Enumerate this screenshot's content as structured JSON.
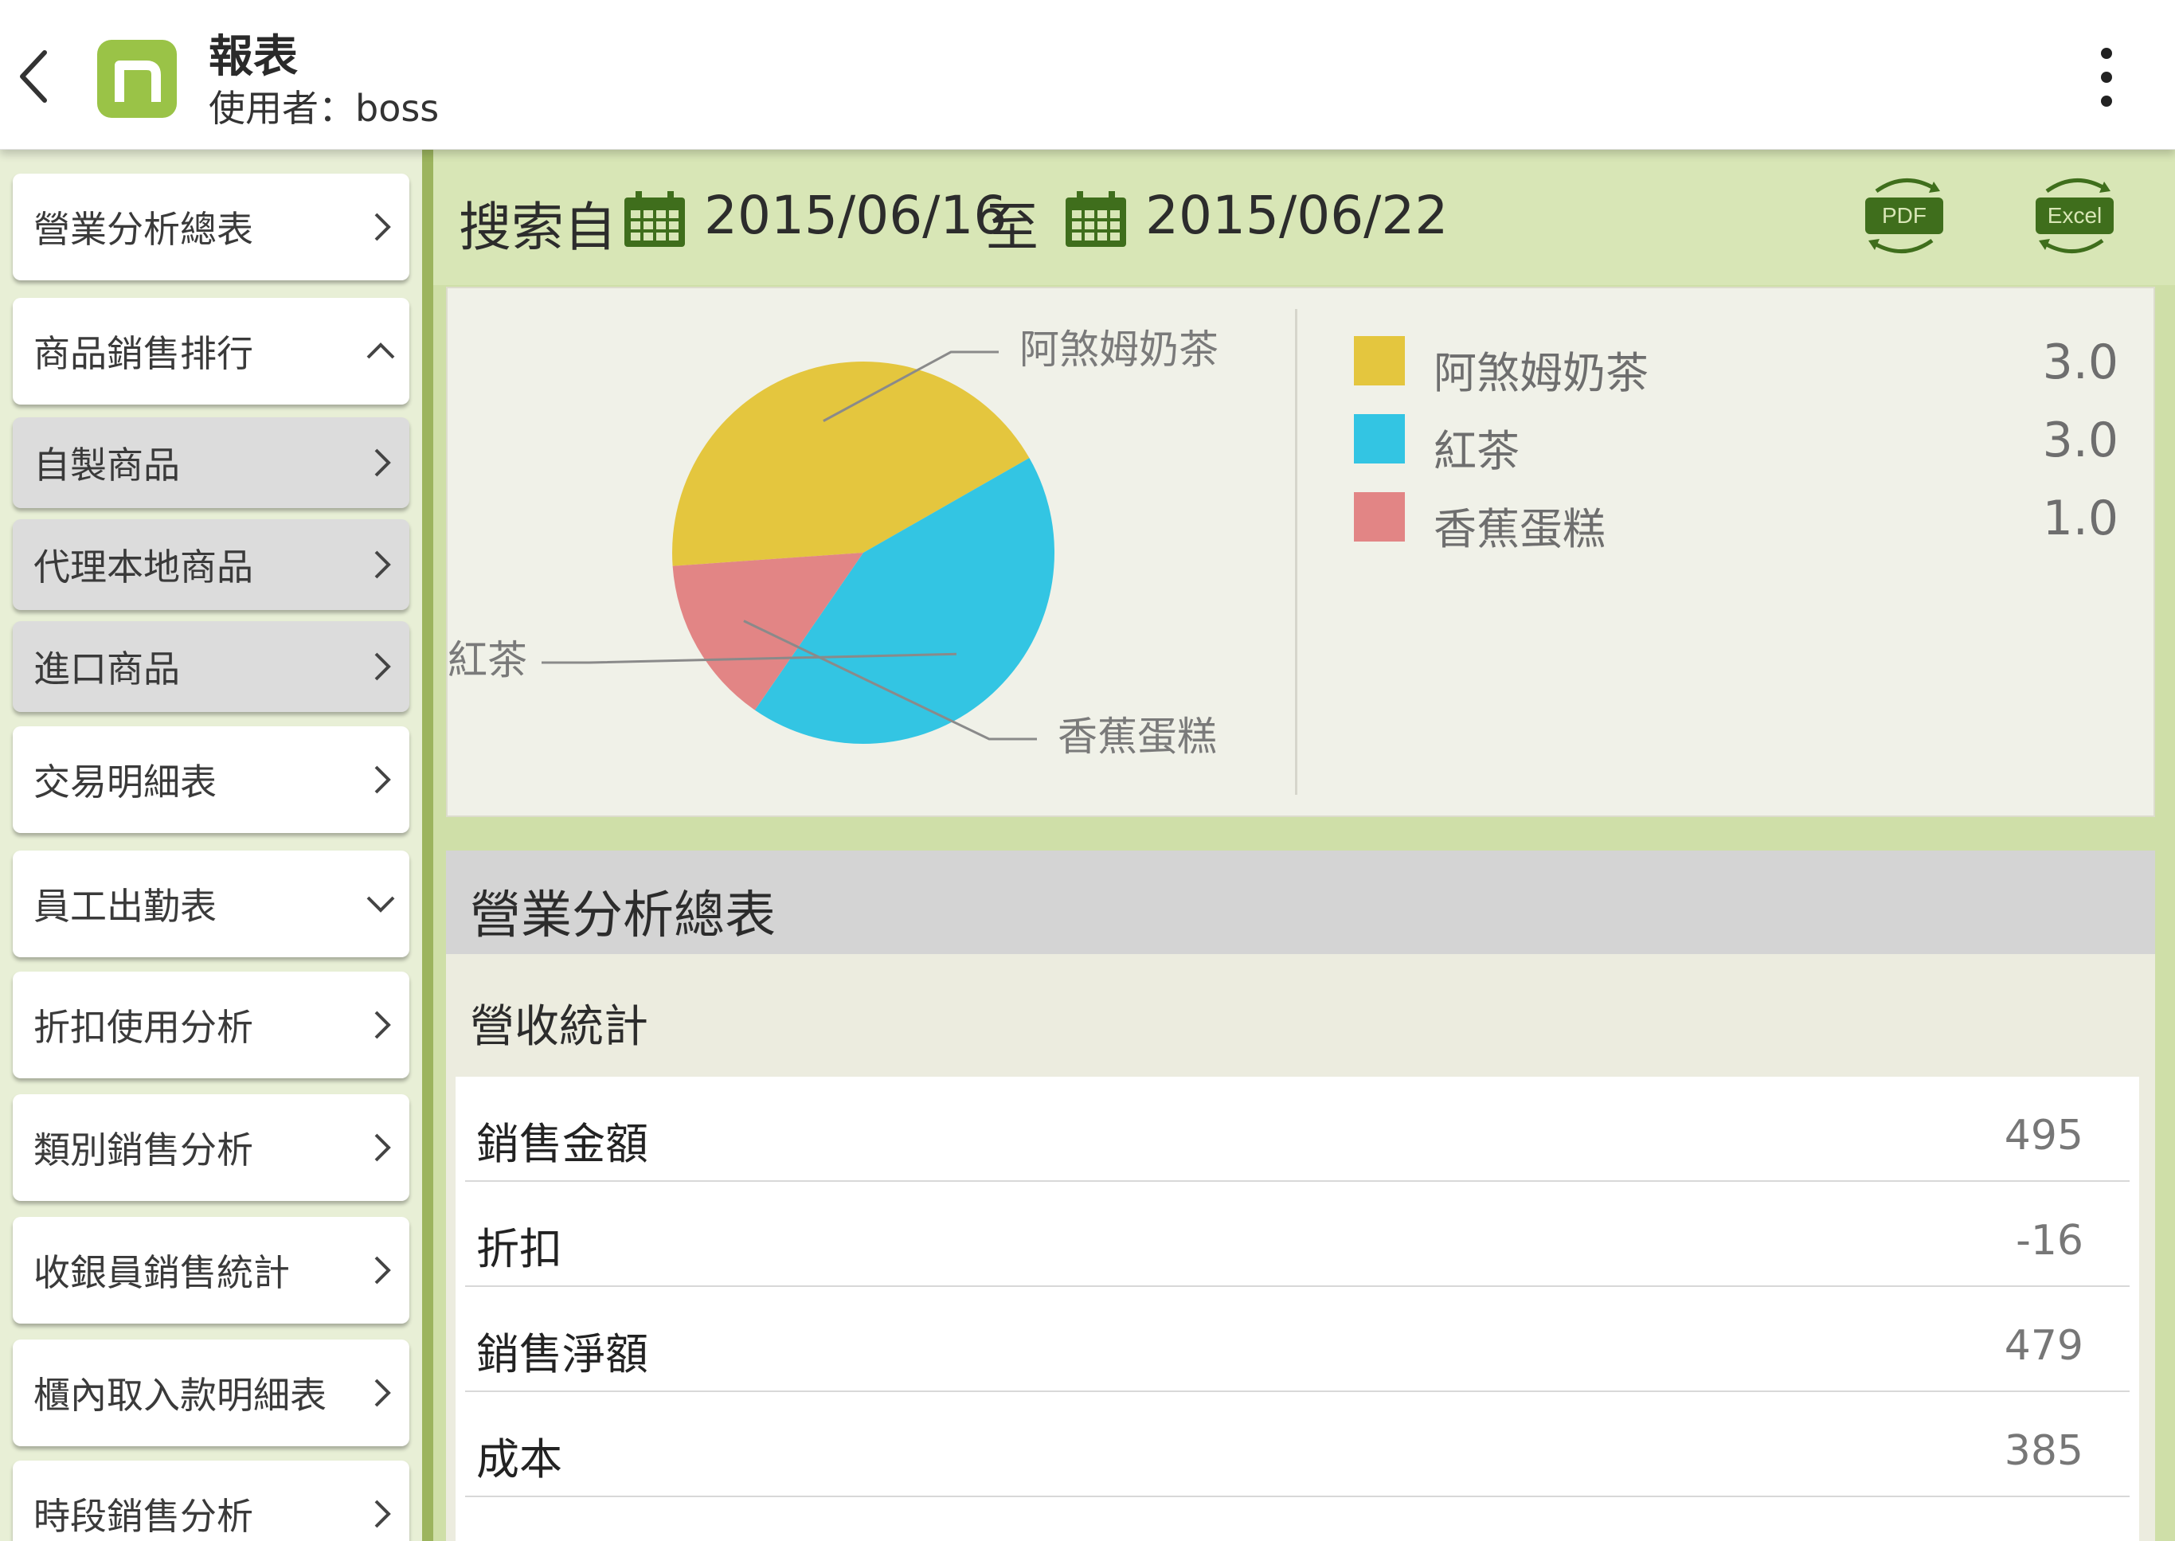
{
  "header": {
    "title": "報表",
    "user_label": "使用者：boss"
  },
  "sidebar": {
    "items": [
      {
        "label": "營業分析總表",
        "arrow": "chevron-right"
      },
      {
        "label": "商品銷售排行",
        "arrow": "chevron-up"
      },
      {
        "label": "自製商品",
        "arrow": "chevron-right"
      },
      {
        "label": "代理本地商品",
        "arrow": "chevron-right"
      },
      {
        "label": "進口商品",
        "arrow": "chevron-right"
      },
      {
        "label": "交易明細表",
        "arrow": "chevron-right"
      },
      {
        "label": "員工出勤表",
        "arrow": "chevron-down"
      },
      {
        "label": "折扣使用分析",
        "arrow": "chevron-right"
      },
      {
        "label": "類別銷售分析",
        "arrow": "chevron-right"
      },
      {
        "label": "收銀員銷售統計",
        "arrow": "chevron-right"
      },
      {
        "label": "櫃內取入款明細表",
        "arrow": "chevron-right"
      },
      {
        "label": "時段銷售分析",
        "arrow": "chevron-right"
      }
    ]
  },
  "search": {
    "prefix": "搜索自",
    "start_date": "2015/06/16",
    "separator": "至",
    "end_date": "2015/06/22",
    "pdf_label": "PDF",
    "excel_label": "Excel"
  },
  "chart_data": {
    "type": "pie",
    "categories": [
      "阿煞姆奶茶",
      "紅茶",
      "香蕉蛋糕"
    ],
    "values": [
      3.0,
      3.0,
      1.0
    ],
    "value_labels": [
      "3.0",
      "3.0",
      "1.0"
    ],
    "colors": [
      "#e4c63e",
      "#33c5e3",
      "#e28585"
    ],
    "legend_placement": "right"
  },
  "summary": {
    "title": "營業分析總表",
    "subtitle": "營收統計",
    "rows": [
      {
        "label": "銷售金額",
        "value": "495"
      },
      {
        "label": "折扣",
        "value": "-16"
      },
      {
        "label": "銷售淨額",
        "value": "479"
      },
      {
        "label": "成本",
        "value": "385"
      }
    ]
  },
  "colors": {
    "brand_green": "#9ac347",
    "icon_dark_green": "#3f6e1c",
    "content_bg": "#cfdfa8"
  }
}
